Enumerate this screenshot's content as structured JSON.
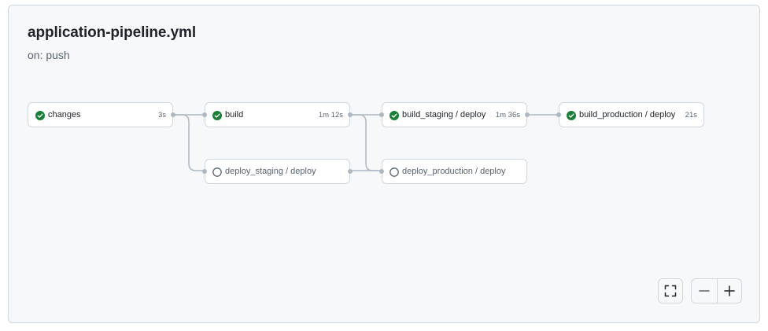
{
  "workflow": {
    "title": "application-pipeline.yml",
    "trigger": "on: push"
  },
  "jobs": [
    {
      "name": "changes",
      "duration": "3s",
      "status": "success"
    },
    {
      "name": "build",
      "duration": "1m 12s",
      "status": "success"
    },
    {
      "name": "deploy_staging / deploy",
      "duration": "",
      "status": "pending"
    },
    {
      "name": "build_staging / deploy",
      "duration": "1m 36s",
      "status": "success"
    },
    {
      "name": "deploy_production / deploy",
      "duration": "",
      "status": "pending"
    },
    {
      "name": "build_production / deploy",
      "duration": "21s",
      "status": "success"
    }
  ],
  "controls": {
    "fullscreen_icon": "fullscreen-icon",
    "zoom_out_icon": "minus-icon",
    "zoom_in_icon": "plus-icon"
  },
  "colors": {
    "success": "#1a7f37",
    "pending": "#59636e",
    "edge": "#afb8c1"
  }
}
